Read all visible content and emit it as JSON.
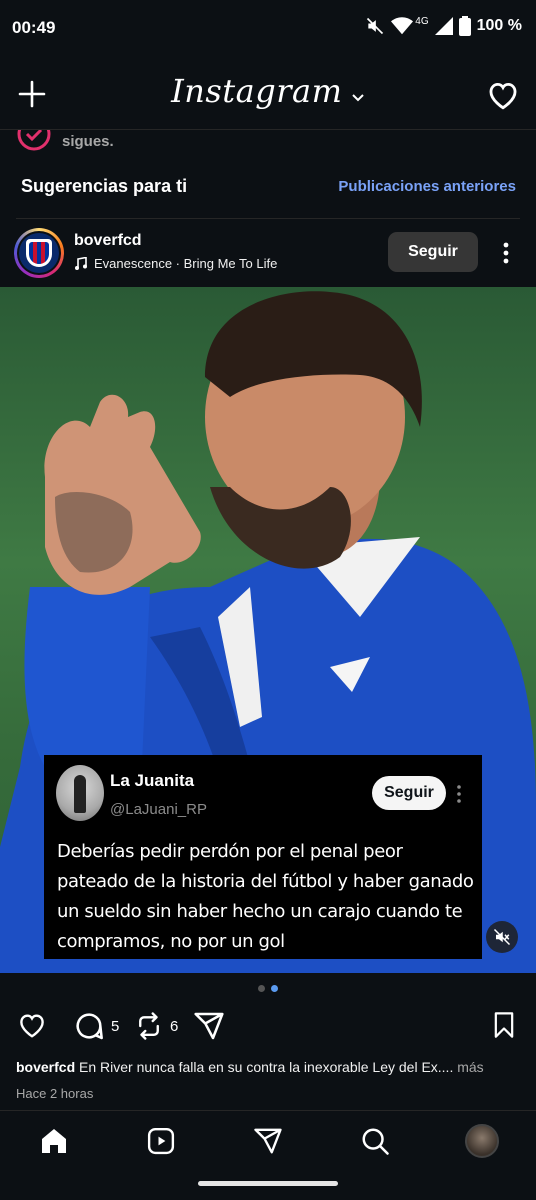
{
  "status_bar": {
    "time": "00:49",
    "network": "4G",
    "battery": "100 %"
  },
  "header": {
    "logo": "Instagram"
  },
  "previous_strip": {
    "text": "sigues."
  },
  "suggestions": {
    "title": "Sugerencias para ti",
    "link": "Publicaciones anteriores"
  },
  "post": {
    "username": "boverfcd",
    "music": "Evanescence · Bring Me To Life",
    "follow_label": "Seguir",
    "tweet": {
      "name": "La Juanita",
      "handle": "@LaJuani_RP",
      "follow_label": "Seguir",
      "text": "Deberías pedir perdón por el penal peor pateado de la historia del fútbol y haber ganado un sueldo sin haber hecho un carajo cuando te compramos, no por un gol"
    },
    "carousel": {
      "current": 2,
      "total": 2
    },
    "comments_count": "5",
    "reposts_count": "6",
    "caption_user": "boverfcd",
    "caption_text": "En River nunca falla en su contra la inexorable Ley del Ex....",
    "caption_more": "más",
    "time_ago": "Hace 2 horas"
  },
  "colors": {
    "background": "#0c1014",
    "link": "#7aa2f7",
    "follow_button": "#363636",
    "carousel_active": "#5b9bf0"
  },
  "icons": {
    "top_left": "plus-icon",
    "top_right": "heart-icon",
    "nav": [
      "home-icon",
      "reels-icon",
      "send-icon",
      "search-icon",
      "profile-avatar"
    ]
  }
}
